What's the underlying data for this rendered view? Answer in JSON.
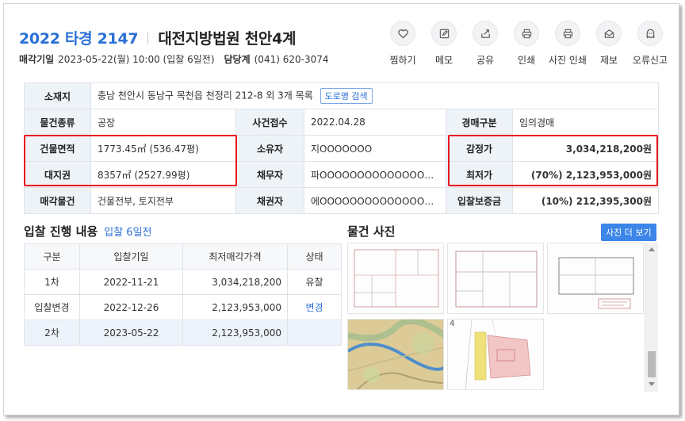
{
  "header": {
    "case_number": "2022 타경 2147",
    "court": "대전지방법원 천안4계",
    "sale_date_label": "매각기일",
    "sale_date_value": "2023-05-22(월) 10:00 (입찰 6일전)",
    "dept_label": "담당계",
    "dept_phone": "(041) 620-3074"
  },
  "actions": [
    {
      "label": "찜하기",
      "icon": "heart-icon"
    },
    {
      "label": "메모",
      "icon": "pencil-icon"
    },
    {
      "label": "공유",
      "icon": "share-icon"
    },
    {
      "label": "인쇄",
      "icon": "printer-icon"
    },
    {
      "label": "사진 인쇄",
      "icon": "printer-icon"
    },
    {
      "label": "제보",
      "icon": "envelope-icon"
    },
    {
      "label": "오류신고",
      "icon": "ghost-icon"
    }
  ],
  "info": {
    "location_label": "소재지",
    "location_value": "충남 천안시 동남구 목천읍 천정리 212-8 외 3개 목록",
    "road_search": "도로명 검색",
    "type_label": "물건종류",
    "type_value": "공장",
    "case_recv_label": "사건접수",
    "case_recv_value": "2022.04.28",
    "auction_kind_label": "경매구분",
    "auction_kind_value": "임의경매",
    "bldg_area_label": "건물면적",
    "bldg_area_value": "1773.45㎡ (536.47평)",
    "owner_label": "소유자",
    "owner_value": "지OOOOOOO",
    "appraisal_label": "감정가",
    "appraisal_value": "3,034,218,200원",
    "land_right_label": "대지권",
    "land_right_value": "8357㎡ (2527.99평)",
    "debtor_label": "채무자",
    "debtor_value": "파OOOOOOOOOOOOOOOO...",
    "min_price_label": "최저가",
    "min_price_value": "(70%) 2,123,953,000원",
    "sale_item_label": "매각물건",
    "sale_item_value": "건물전부, 토지전부",
    "creditor_label": "채권자",
    "creditor_value": "에OOOOOOOOOOOOOOOO...",
    "deposit_label": "입찰보증금",
    "deposit_value": "(10%) 212,395,300원"
  },
  "bids": {
    "title": "입찰 진행 내용",
    "subtitle": "입찰 6일전",
    "columns": [
      "구분",
      "입찰기일",
      "최저매각가격",
      "상태"
    ],
    "rows": [
      [
        "1차",
        "2022-11-21",
        "3,034,218,200",
        "유찰"
      ],
      [
        "입찰변경",
        "2022-12-26",
        "2,123,953,000",
        "변경"
      ],
      [
        "2차",
        "2023-05-22",
        "2,123,953,000",
        ""
      ]
    ]
  },
  "photos": {
    "title": "물건 사진",
    "more_button": "사진 더 보기",
    "thumb_number": "4"
  },
  "colors": {
    "accent": "#2a6fd6",
    "highlight_box": "#e8141d",
    "header_cell": "#eef3f8"
  }
}
